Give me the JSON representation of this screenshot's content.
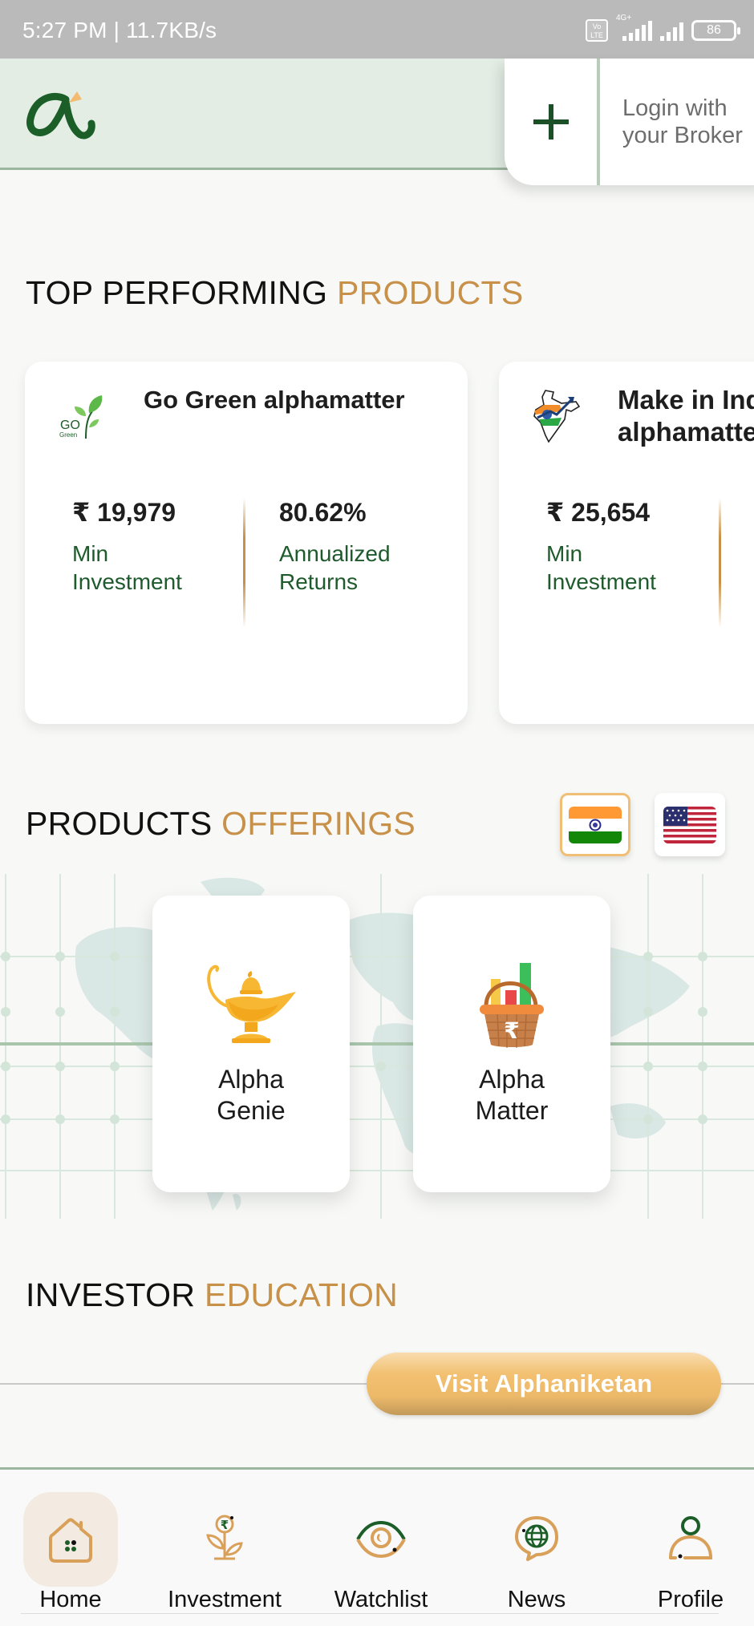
{
  "status_bar": {
    "time_speed": "5:27 PM | 11.7KB/s",
    "volte": "Vo LTE",
    "network": "4G+",
    "battery": "86"
  },
  "header": {
    "logo": "alpha-logo",
    "login_label_line1": "Login with",
    "login_label_line2": "your Broker",
    "add_icon": "plus-icon"
  },
  "top_products": {
    "title": "TOP PERFORMING",
    "title_accent": "PRODUCTS",
    "cards": [
      {
        "name": "Go Green alphamatter",
        "icon": "go-green-logo",
        "min_investment": "₹ 19,979",
        "min_investment_label_1": "Min",
        "min_investment_label_2": "Investment",
        "returns": "80.62%",
        "returns_label_1": "Annualized",
        "returns_label_2": "Returns"
      },
      {
        "name_line1": "Make in India",
        "name_line2": "alphamatter",
        "icon": "make-in-india-logo",
        "min_investment": "₹ 25,654",
        "min_investment_label_1": "Min",
        "min_investment_label_2": "Investment"
      }
    ]
  },
  "offerings": {
    "title": "PRODUCTS",
    "title_accent": "OFFERINGS",
    "regions": [
      {
        "name": "India",
        "icon": "india-flag-icon",
        "selected": true
      },
      {
        "name": "USA",
        "icon": "us-flag-icon",
        "selected": false
      }
    ],
    "items": [
      {
        "line1": "Alpha",
        "line2": "Genie",
        "icon": "magic-lamp-icon"
      },
      {
        "line1": "Alpha",
        "line2": "Matter",
        "icon": "rupee-basket-icon"
      }
    ]
  },
  "education": {
    "title": "INVESTOR",
    "title_accent": "EDUCATION",
    "button_label": "Visit Alphaniketan"
  },
  "bottom_nav": [
    {
      "label": "Home",
      "icon": "home-icon",
      "active": true
    },
    {
      "label": "Investment",
      "icon": "investment-plant-icon",
      "active": false
    },
    {
      "label": "Watchlist",
      "icon": "eye-icon",
      "active": false
    },
    {
      "label": "News",
      "icon": "globe-chat-icon",
      "active": false
    },
    {
      "label": "Profile",
      "icon": "profile-icon",
      "active": false
    }
  ],
  "colors": {
    "brand_green": "#1f5a2c",
    "accent_gold": "#c8914a",
    "header_bg": "#e3ede4",
    "button_gold": "#f2c070"
  }
}
